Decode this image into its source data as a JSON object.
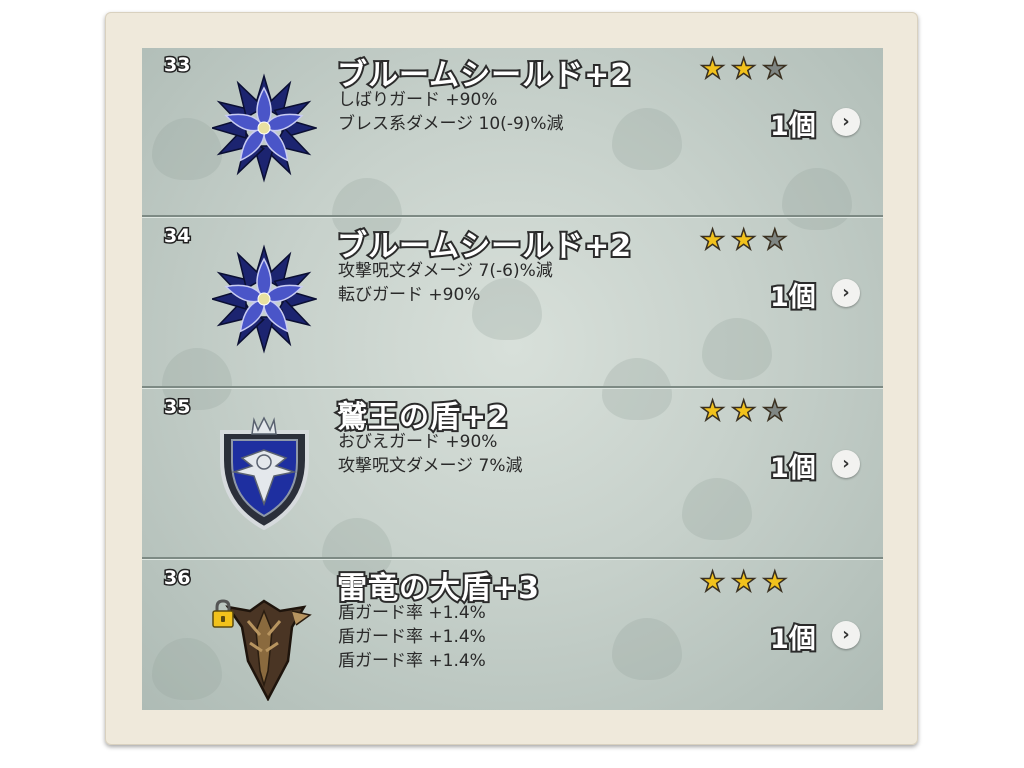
{
  "items": [
    {
      "number": "33",
      "name": "ブルームシールド+2",
      "icon": "blue-flower-shield-icon",
      "stats": [
        "しばりガード +90%",
        "ブレス系ダメージ 10(-9)%減"
      ],
      "stars": 2,
      "max_stars": 3,
      "count": "1個",
      "locked": false
    },
    {
      "number": "34",
      "name": "ブルームシールド+2",
      "icon": "blue-flower-shield-icon",
      "stats": [
        "攻撃呪文ダメージ 7(-6)%減",
        "転びガード +90%"
      ],
      "stars": 2,
      "max_stars": 3,
      "count": "1個",
      "locked": false
    },
    {
      "number": "35",
      "name": "鷲王の盾+2",
      "icon": "eagle-crest-shield-icon",
      "stats": [
        "おびえガード +90%",
        "攻撃呪文ダメージ 7%減"
      ],
      "stars": 2,
      "max_stars": 3,
      "count": "1個",
      "locked": false
    },
    {
      "number": "36",
      "name": "雷竜の大盾+3",
      "icon": "thunder-dragon-shield-icon",
      "stats": [
        "盾ガード率 +1.4%",
        "盾ガード率 +1.4%",
        "盾ガード率 +1.4%"
      ],
      "stars": 3,
      "max_stars": 3,
      "count": "1個",
      "locked": true
    }
  ],
  "colors": {
    "star_on": "#f2c21c",
    "star_off": "#7f8683",
    "panel": "#c7d1cb",
    "frame": "#efe9db"
  },
  "icons": {
    "star": "star-icon",
    "chevron": "chevron-right-icon",
    "lock": "padlock-icon"
  }
}
